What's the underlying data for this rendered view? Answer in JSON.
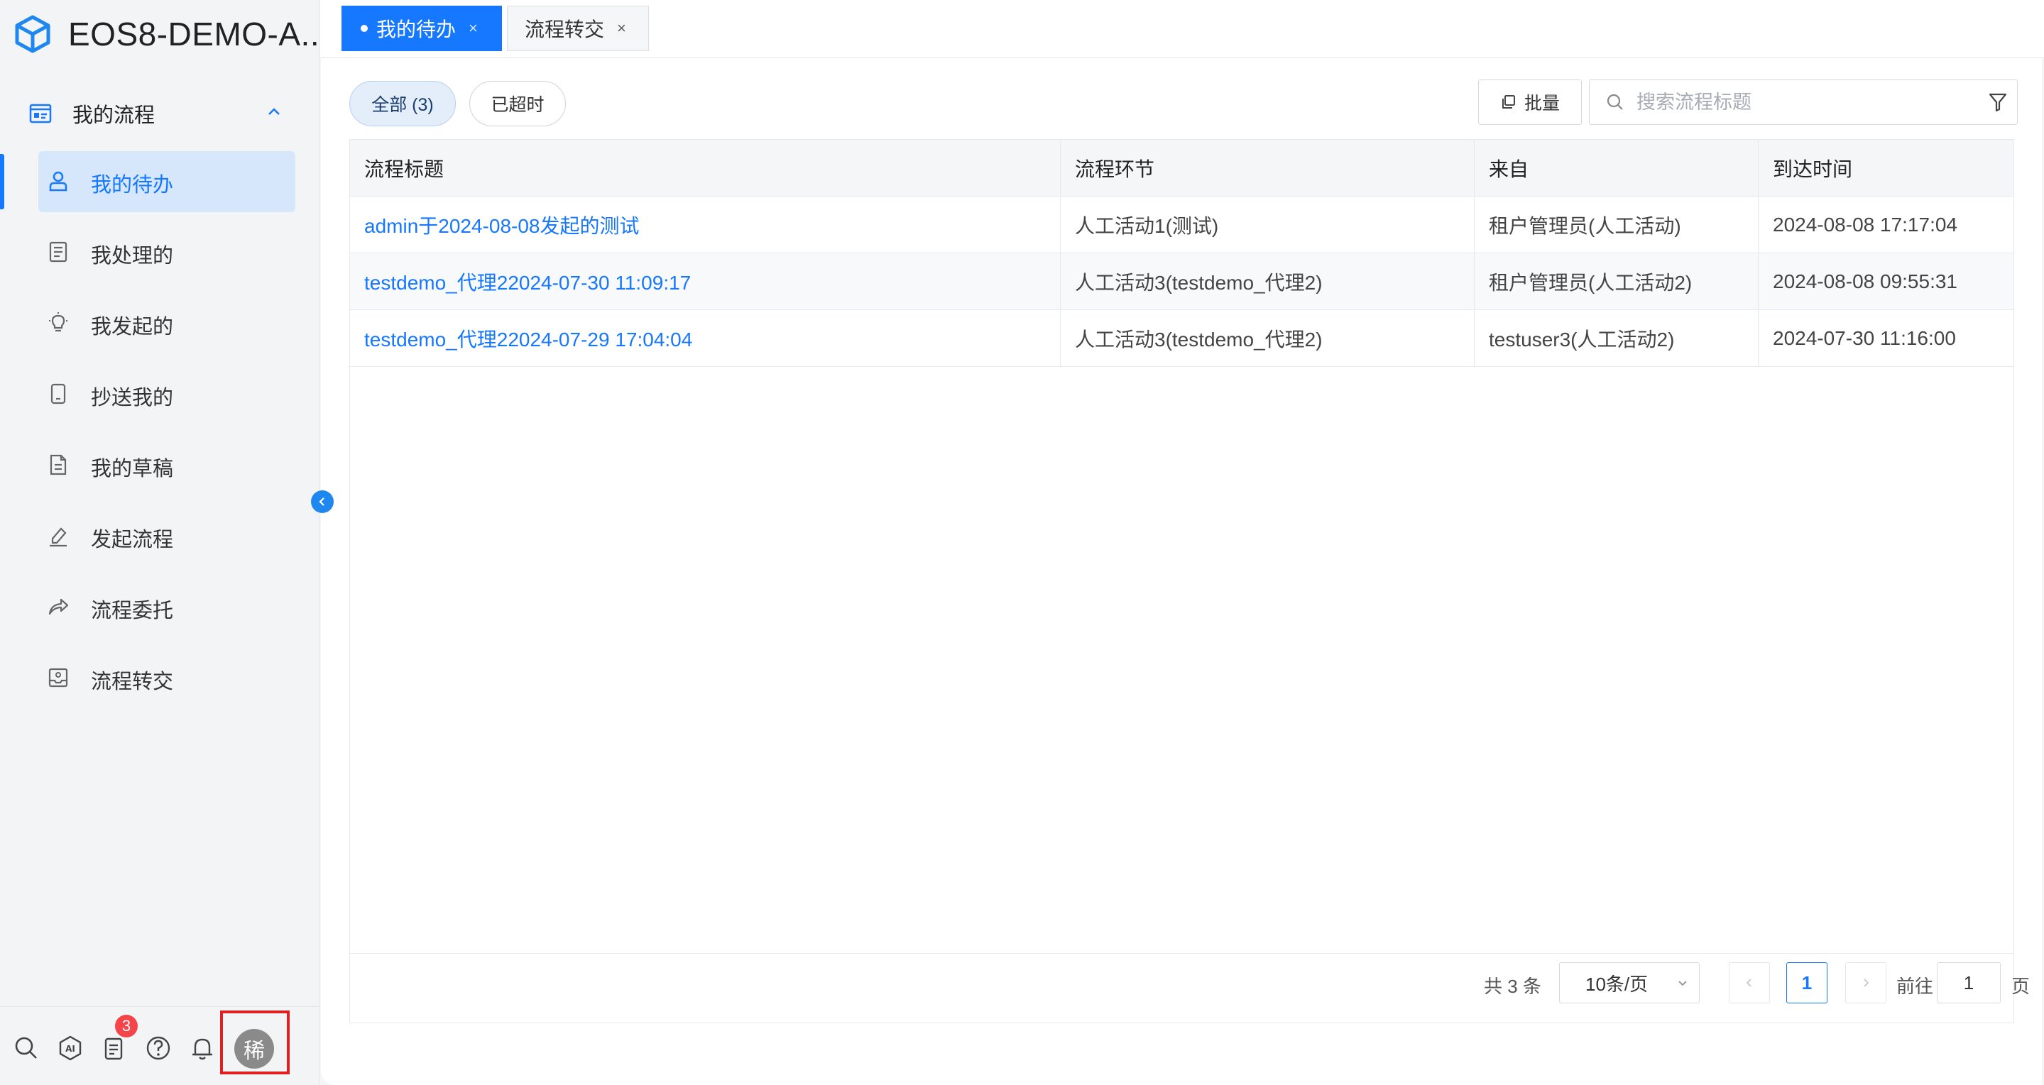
{
  "app": {
    "title": "EOS8-DEMO-A..."
  },
  "sidebar": {
    "group_label": "我的流程",
    "items": [
      {
        "label": "我的待办",
        "icon": "user-icon",
        "active": true
      },
      {
        "label": "我处理的",
        "icon": "document-list-icon",
        "active": false
      },
      {
        "label": "我发起的",
        "icon": "lightbulb-icon",
        "active": false
      },
      {
        "label": "抄送我的",
        "icon": "tablet-icon",
        "active": false
      },
      {
        "label": "我的草稿",
        "icon": "draft-document-icon",
        "active": false
      },
      {
        "label": "发起流程",
        "icon": "pen-sign-icon",
        "active": false
      },
      {
        "label": "流程委托",
        "icon": "share-arrow-icon",
        "active": false
      },
      {
        "label": "流程转交",
        "icon": "transfer-tray-icon",
        "active": false
      }
    ],
    "bottom_icons": [
      "search-icon",
      "ai-icon",
      "task-list-icon",
      "help-icon",
      "bell-icon"
    ],
    "notification_count": "3",
    "avatar_text": "稀"
  },
  "tabs": [
    {
      "label": "我的待办",
      "active": true
    },
    {
      "label": "流程转交",
      "active": false
    }
  ],
  "filters": {
    "all_label": "全部 (3)",
    "overdue_label": "已超时"
  },
  "toolbar": {
    "batch_label": "批量",
    "search_placeholder": "搜索流程标题"
  },
  "table": {
    "columns": [
      "流程标题",
      "流程环节",
      "来自",
      "到达时间"
    ],
    "rows": [
      [
        "admin于2024-08-08发起的测试",
        "人工活动1(测试)",
        "租户管理员(人工活动)",
        "2024-08-08 17:17:04"
      ],
      [
        "testdemo_代理22024-07-30 11:09:17",
        "人工活动3(testdemo_代理2)",
        "租户管理员(人工活动2)",
        "2024-08-08 09:55:31"
      ],
      [
        "testdemo_代理22024-07-29 17:04:04",
        "人工活动3(testdemo_代理2)",
        "testuser3(人工活动2)",
        "2024-07-30 11:16:00"
      ]
    ]
  },
  "pagination": {
    "total_text": "共 3 条",
    "page_size": "10条/页",
    "current_page": "1",
    "goto_label": "前往",
    "goto_value": "1",
    "page_suffix": "页"
  },
  "colors": {
    "accent": "#1677ff",
    "badge": "#f5454b",
    "highlight_frame": "#e02020"
  }
}
